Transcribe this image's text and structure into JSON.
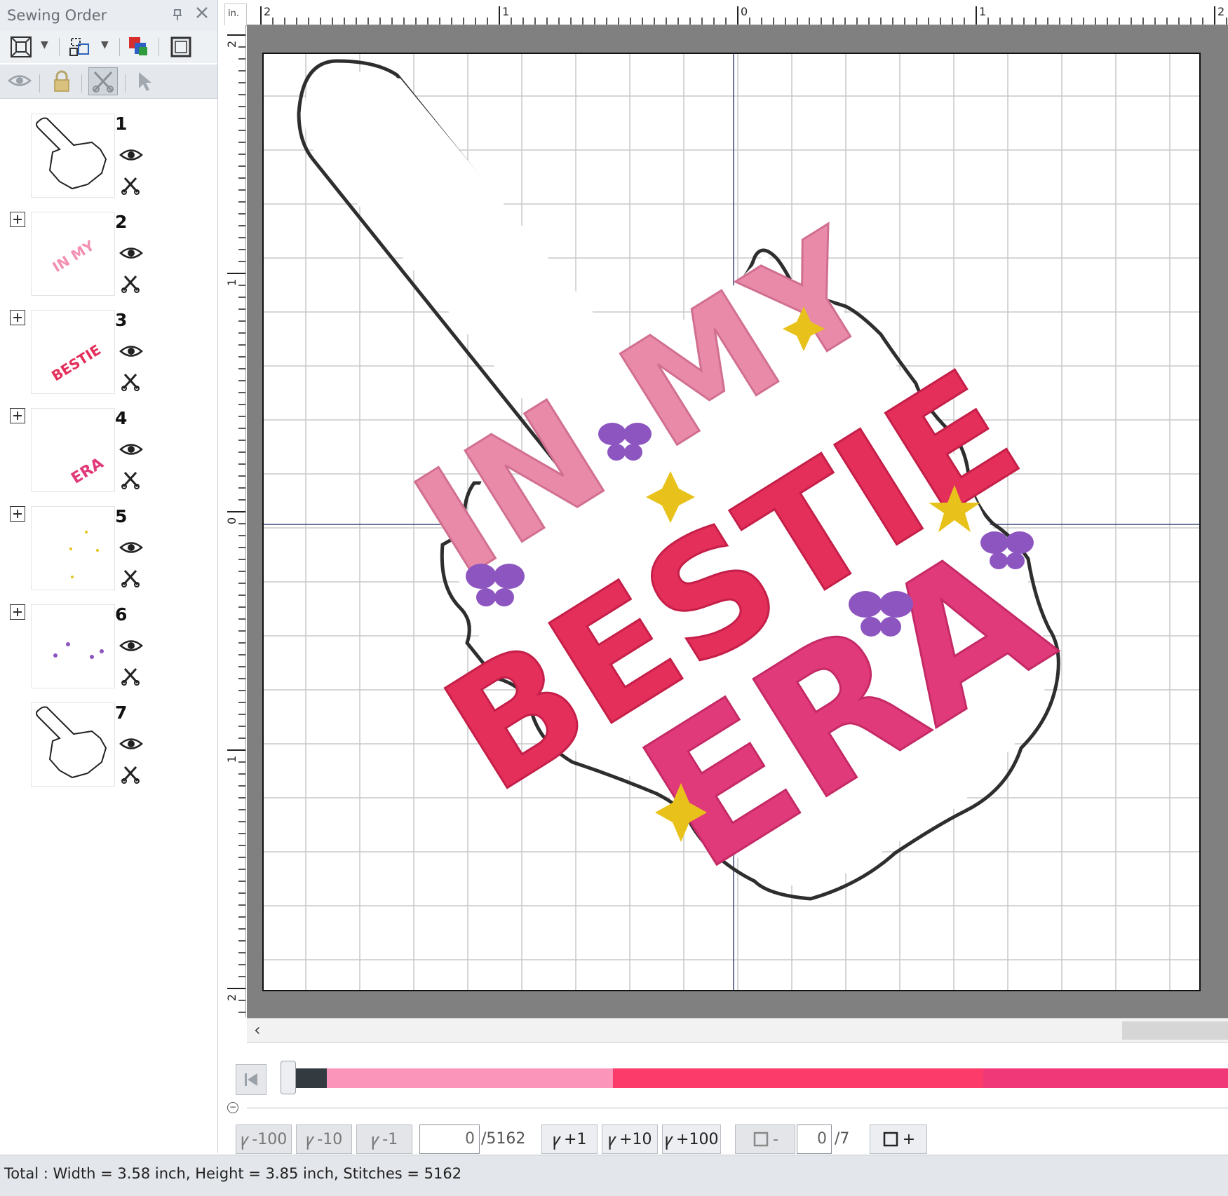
{
  "panel": {
    "title": "Sewing Order",
    "pin_glyph": "📌",
    "close_glyph": "✕",
    "toolbar1_icons": [
      "fit-view-icon",
      "group-icon",
      "color-order-icon",
      "frame-icon"
    ],
    "toolbar2_icons": [
      "visibility-icon",
      "lock-icon",
      "trim-icon",
      "select-arrow-icon"
    ],
    "items": [
      {
        "number": "1",
        "expandable": false,
        "thumb": "outline-tag"
      },
      {
        "number": "2",
        "expandable": true,
        "thumb": "in-my-text"
      },
      {
        "number": "3",
        "expandable": true,
        "thumb": "bestie-text"
      },
      {
        "number": "4",
        "expandable": true,
        "thumb": "era-text"
      },
      {
        "number": "5",
        "expandable": true,
        "thumb": "stars"
      },
      {
        "number": "6",
        "expandable": true,
        "thumb": "butterflies"
      },
      {
        "number": "7",
        "expandable": false,
        "thumb": "outline-tag"
      }
    ]
  },
  "rulers": {
    "unit": "in.",
    "h_labels": [
      "2",
      "1",
      "0",
      "1",
      "2"
    ],
    "v_labels": [
      "2",
      "1",
      "0",
      "1",
      "2"
    ]
  },
  "design": {
    "line1": "IN MY",
    "line2": "BESTIE",
    "line3": "ERA",
    "colors": {
      "outline": "#2e2e2e",
      "in_my": "#e88aa8",
      "bestie": "#e32f5a",
      "era": "#e03a7a",
      "stars": "#e8c21a",
      "butterflies": "#8d55c0"
    }
  },
  "slider": {
    "segments": [
      {
        "color": "#333a40",
        "fraction": 0.036
      },
      {
        "color": "#fb95ba",
        "fraction": 0.306
      },
      {
        "color": "#fc3b6a",
        "fraction": 0.396
      },
      {
        "color": "#f03878",
        "fraction": 0.262
      }
    ]
  },
  "stepper": {
    "minus100": "-100",
    "minus10": "-10",
    "minus1": "-1",
    "stitch_value": "0",
    "stitch_total": "/5162",
    "plus1": "+1",
    "plus10": "+10",
    "plus100": "+100",
    "color_minus": "-",
    "color_value": "0",
    "color_total": "/7",
    "color_plus": "+"
  },
  "status": {
    "text": "Total : Width = 3.58 inch, Height = 3.85 inch, Stitches = 5162"
  }
}
